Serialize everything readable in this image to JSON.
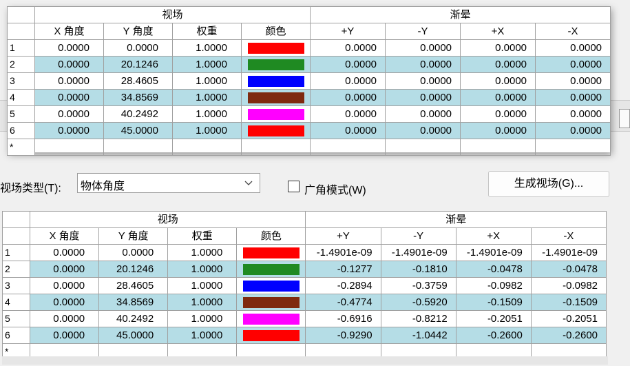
{
  "top_table": {
    "group_headers": {
      "field": "视场",
      "vignetting": "渐晕"
    },
    "col_headers": [
      "X 角度",
      "Y 角度",
      "权重",
      "颜色",
      "+Y",
      "-Y",
      "+X",
      "-X"
    ],
    "rows": [
      {
        "id": "1",
        "x": "0.0000",
        "y": "0.0000",
        "w": "1.0000",
        "color": "#ff0000",
        "py": "0.0000",
        "my": "0.0000",
        "px": "0.0000",
        "mx": "0.0000"
      },
      {
        "id": "2",
        "x": "0.0000",
        "y": "20.1246",
        "w": "1.0000",
        "color": "#1f8a22",
        "py": "0.0000",
        "my": "0.0000",
        "px": "0.0000",
        "mx": "0.0000"
      },
      {
        "id": "3",
        "x": "0.0000",
        "y": "28.4605",
        "w": "1.0000",
        "color": "#0000ff",
        "py": "0.0000",
        "my": "0.0000",
        "px": "0.0000",
        "mx": "0.0000"
      },
      {
        "id": "4",
        "x": "0.0000",
        "y": "34.8569",
        "w": "1.0000",
        "color": "#7f2a10",
        "py": "0.0000",
        "my": "0.0000",
        "px": "0.0000",
        "mx": "0.0000"
      },
      {
        "id": "5",
        "x": "0.0000",
        "y": "40.2492",
        "w": "1.0000",
        "color": "#ff00ff",
        "py": "0.0000",
        "my": "0.0000",
        "px": "0.0000",
        "mx": "0.0000"
      },
      {
        "id": "6",
        "x": "0.0000",
        "y": "45.0000",
        "w": "1.0000",
        "color": "#ff0000",
        "py": "0.0000",
        "my": "0.0000",
        "px": "0.0000",
        "mx": "0.0000"
      }
    ],
    "new_row_marker": "*"
  },
  "controls": {
    "field_type_label": "视场类型(T):",
    "field_type_value": "物体角度",
    "wide_angle_label": "广角模式(W)",
    "generate_label": "生成视场(G)..."
  },
  "bottom_table": {
    "group_headers": {
      "field": "视场",
      "vignetting": "渐晕"
    },
    "col_headers": [
      "X 角度",
      "Y 角度",
      "权重",
      "颜色",
      "+Y",
      "-Y",
      "+X",
      "-X"
    ],
    "rows": [
      {
        "id": "1",
        "x": "0.0000",
        "y": "0.0000",
        "w": "1.0000",
        "color": "#ff0000",
        "py": "-1.4901e-09",
        "my": "-1.4901e-09",
        "px": "-1.4901e-09",
        "mx": "-1.4901e-09"
      },
      {
        "id": "2",
        "x": "0.0000",
        "y": "20.1246",
        "w": "1.0000",
        "color": "#1f8a22",
        "py": "-0.1277",
        "my": "-0.1810",
        "px": "-0.0478",
        "mx": "-0.0478"
      },
      {
        "id": "3",
        "x": "0.0000",
        "y": "28.4605",
        "w": "1.0000",
        "color": "#0000ff",
        "py": "-0.2894",
        "my": "-0.3759",
        "px": "-0.0982",
        "mx": "-0.0982"
      },
      {
        "id": "4",
        "x": "0.0000",
        "y": "34.8569",
        "w": "1.0000",
        "color": "#7f2a10",
        "py": "-0.4774",
        "my": "-0.5920",
        "px": "-0.1509",
        "mx": "-0.1509"
      },
      {
        "id": "5",
        "x": "0.0000",
        "y": "40.2492",
        "w": "1.0000",
        "color": "#ff00ff",
        "py": "-0.6916",
        "my": "-0.8212",
        "px": "-0.2051",
        "mx": "-0.2051"
      },
      {
        "id": "6",
        "x": "0.0000",
        "y": "45.0000",
        "w": "1.0000",
        "color": "#ff0000",
        "py": "-0.9290",
        "my": "-1.0442",
        "px": "-0.2600",
        "mx": "-0.2600"
      }
    ],
    "new_row_marker": "*"
  }
}
